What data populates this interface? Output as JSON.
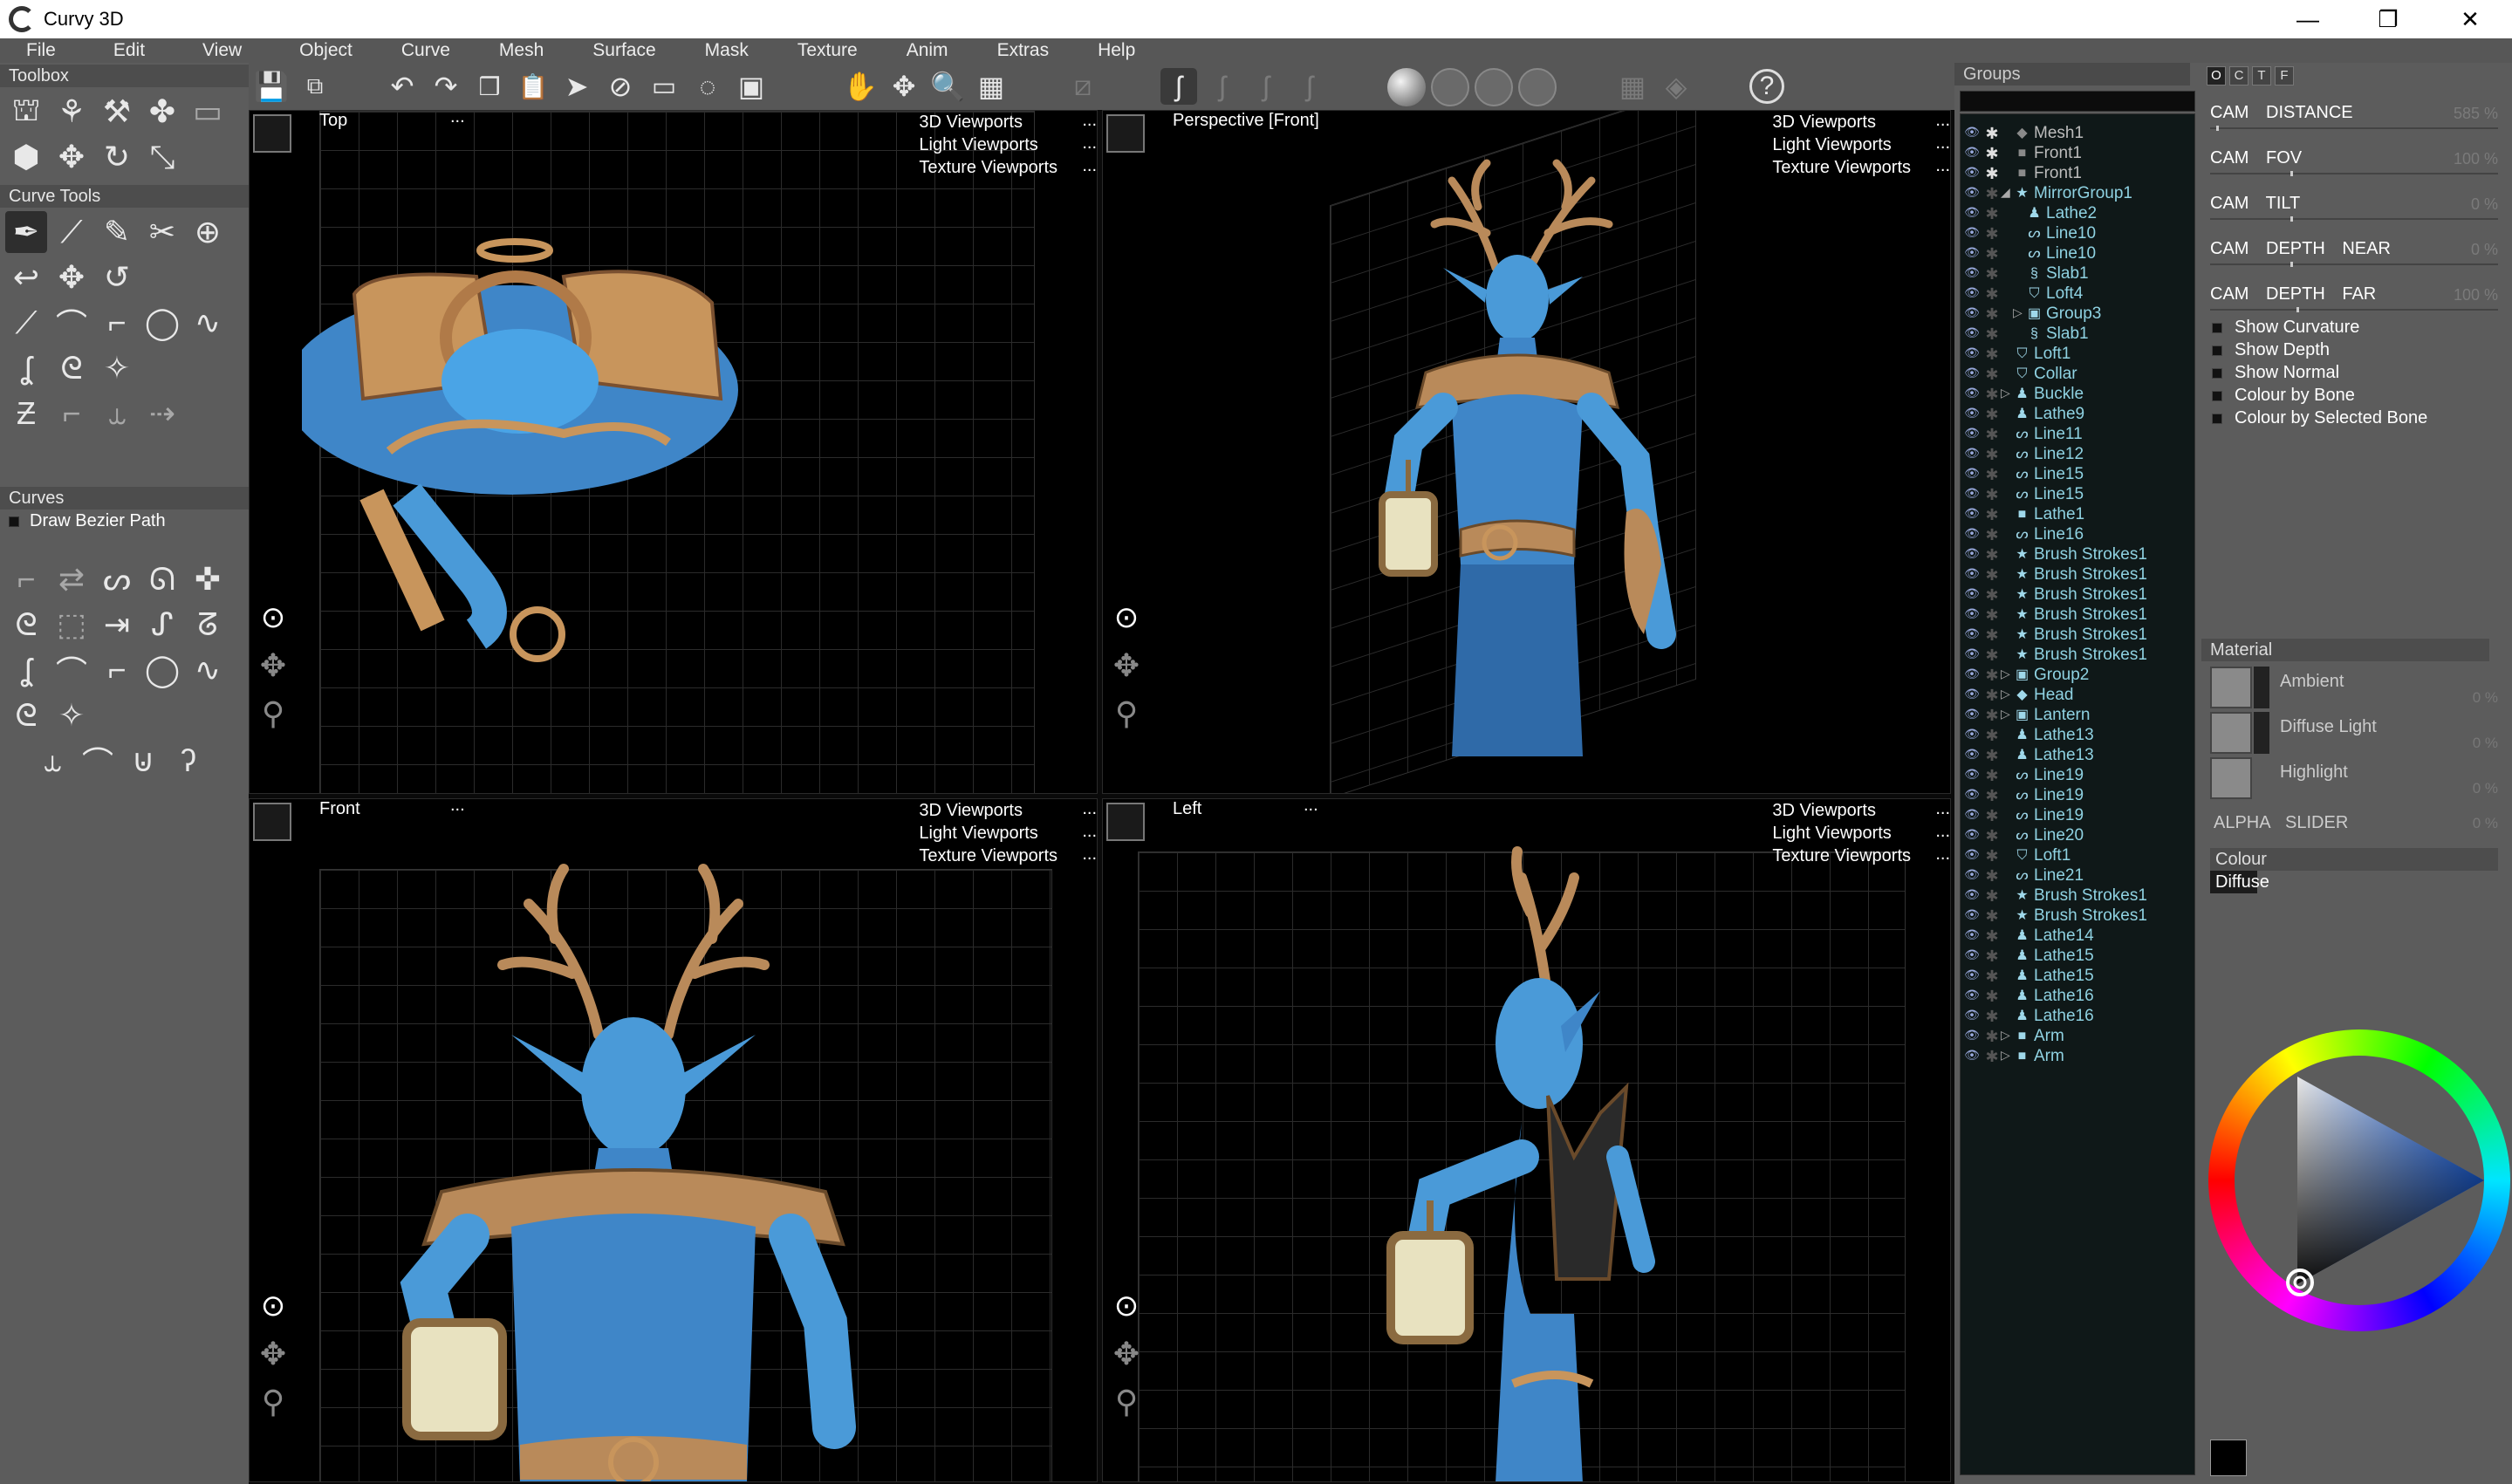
{
  "app": {
    "title": "Curvy 3D"
  },
  "menu": [
    "File",
    "Edit",
    "View",
    "Object",
    "Curve",
    "Mesh",
    "Surface",
    "Mask",
    "Texture",
    "Anim",
    "Extras",
    "Help"
  ],
  "left": {
    "toolbox": "Toolbox",
    "curve_tools": "Curve Tools",
    "curves": "Curves",
    "draw_bezier": "Draw Bezier Path"
  },
  "viewports": {
    "menu": [
      "3D Viewports",
      "Light Viewports",
      "Texture Viewports"
    ],
    "more": "...",
    "names": [
      "Top",
      "Perspective [Front]",
      "Front",
      "Left"
    ]
  },
  "groups": {
    "title": "Groups",
    "items": [
      {
        "name": "Mesh1",
        "icon": "diamond",
        "indent": 0,
        "dim": true
      },
      {
        "name": "Front1",
        "icon": "square",
        "indent": 0,
        "dim": true
      },
      {
        "name": "Front1",
        "icon": "square",
        "indent": 0,
        "dim": true
      },
      {
        "name": "MirrorGroup1",
        "icon": "star",
        "indent": 0,
        "arrow": "open"
      },
      {
        "name": "Lathe2",
        "icon": "person",
        "indent": 1
      },
      {
        "name": "Line10",
        "icon": "curve",
        "indent": 1
      },
      {
        "name": "Line10",
        "icon": "curve",
        "indent": 1
      },
      {
        "name": "Slab1",
        "icon": "slab",
        "indent": 1
      },
      {
        "name": "Loft4",
        "icon": "loft",
        "indent": 1
      },
      {
        "name": "Group3",
        "icon": "folder",
        "indent": 1,
        "arrow": "closed"
      },
      {
        "name": "Slab1",
        "icon": "slab",
        "indent": 1
      },
      {
        "name": "Loft1",
        "icon": "loft",
        "indent": 0
      },
      {
        "name": "Collar",
        "icon": "loft",
        "indent": 0
      },
      {
        "name": "Buckle",
        "icon": "person",
        "indent": 0,
        "arrow": "closed"
      },
      {
        "name": "Lathe9",
        "icon": "person",
        "indent": 0
      },
      {
        "name": "Line11",
        "icon": "curve",
        "indent": 0
      },
      {
        "name": "Line12",
        "icon": "curve",
        "indent": 0
      },
      {
        "name": "Line15",
        "icon": "curve",
        "indent": 0
      },
      {
        "name": "Line15",
        "icon": "curve",
        "indent": 0
      },
      {
        "name": "Lathe1",
        "icon": "square",
        "indent": 0
      },
      {
        "name": "Line16",
        "icon": "curve",
        "indent": 0
      },
      {
        "name": "Brush Strokes1",
        "icon": "star",
        "indent": 0
      },
      {
        "name": "Brush Strokes1",
        "icon": "star",
        "indent": 0
      },
      {
        "name": "Brush Strokes1",
        "icon": "star",
        "indent": 0
      },
      {
        "name": "Brush Strokes1",
        "icon": "star",
        "indent": 0
      },
      {
        "name": "Brush Strokes1",
        "icon": "star",
        "indent": 0
      },
      {
        "name": "Brush Strokes1",
        "icon": "star",
        "indent": 0
      },
      {
        "name": "Group2",
        "icon": "folder",
        "indent": 0,
        "arrow": "closed"
      },
      {
        "name": "Head",
        "icon": "diamond",
        "indent": 0,
        "arrow": "closed"
      },
      {
        "name": "Lantern",
        "icon": "folder",
        "indent": 0,
        "arrow": "closed"
      },
      {
        "name": "Lathe13",
        "icon": "person",
        "indent": 0
      },
      {
        "name": "Lathe13",
        "icon": "person",
        "indent": 0
      },
      {
        "name": "Line19",
        "icon": "curve",
        "indent": 0
      },
      {
        "name": "Line19",
        "icon": "curve",
        "indent": 0
      },
      {
        "name": "Line19",
        "icon": "curve",
        "indent": 0
      },
      {
        "name": "Line20",
        "icon": "curve",
        "indent": 0
      },
      {
        "name": "Loft1",
        "icon": "loft",
        "indent": 0
      },
      {
        "name": "Line21",
        "icon": "curve",
        "indent": 0
      },
      {
        "name": "Brush Strokes1",
        "icon": "star",
        "indent": 0
      },
      {
        "name": "Brush Strokes1",
        "icon": "star",
        "indent": 0
      },
      {
        "name": "Lathe14",
        "icon": "person",
        "indent": 0
      },
      {
        "name": "Lathe15",
        "icon": "person",
        "indent": 0
      },
      {
        "name": "Lathe15",
        "icon": "person",
        "indent": 0
      },
      {
        "name": "Lathe16",
        "icon": "person",
        "indent": 0
      },
      {
        "name": "Lathe16",
        "icon": "person",
        "indent": 0
      },
      {
        "name": "Arm",
        "icon": "square",
        "indent": 0,
        "arrow": "closed"
      },
      {
        "name": "Arm",
        "icon": "square",
        "indent": 0,
        "arrow": "closed"
      }
    ]
  },
  "right": {
    "tabs": [
      "O",
      "C",
      "T",
      "F"
    ],
    "sliders": [
      {
        "label": "CAM DISTANCE",
        "value": "585 %",
        "pos": 0.02
      },
      {
        "label": "CAM FOV",
        "value": "100 %",
        "pos": 0.28
      },
      {
        "label": "CAM TILT",
        "value": "0 %",
        "pos": 0.28
      },
      {
        "label": "CAM DEPTH NEAR",
        "value": "0 %",
        "pos": 0.28
      },
      {
        "label": "CAM DEPTH FAR",
        "value": "100 %",
        "pos": 0.3
      }
    ],
    "checks": [
      "Show Curvature",
      "Show Depth",
      "Show Normal",
      "Colour by Bone",
      "Colour by Selected Bone"
    ],
    "material": {
      "title": "Material",
      "rows": [
        {
          "label": "Ambient",
          "value": "0 %"
        },
        {
          "label": "Diffuse Light",
          "value": "0 %"
        },
        {
          "label": "Highlight",
          "value": "0 %"
        }
      ],
      "alpha": {
        "label": "ALPHA SLIDER",
        "value": "0 %"
      }
    },
    "colour": {
      "title": "Colour",
      "tab": "Diffuse"
    }
  },
  "colors": {
    "accent": "#8fd2e2",
    "panel": "#5c5c5c",
    "skin": "#4a9ad8",
    "gold": "#c8955c"
  }
}
